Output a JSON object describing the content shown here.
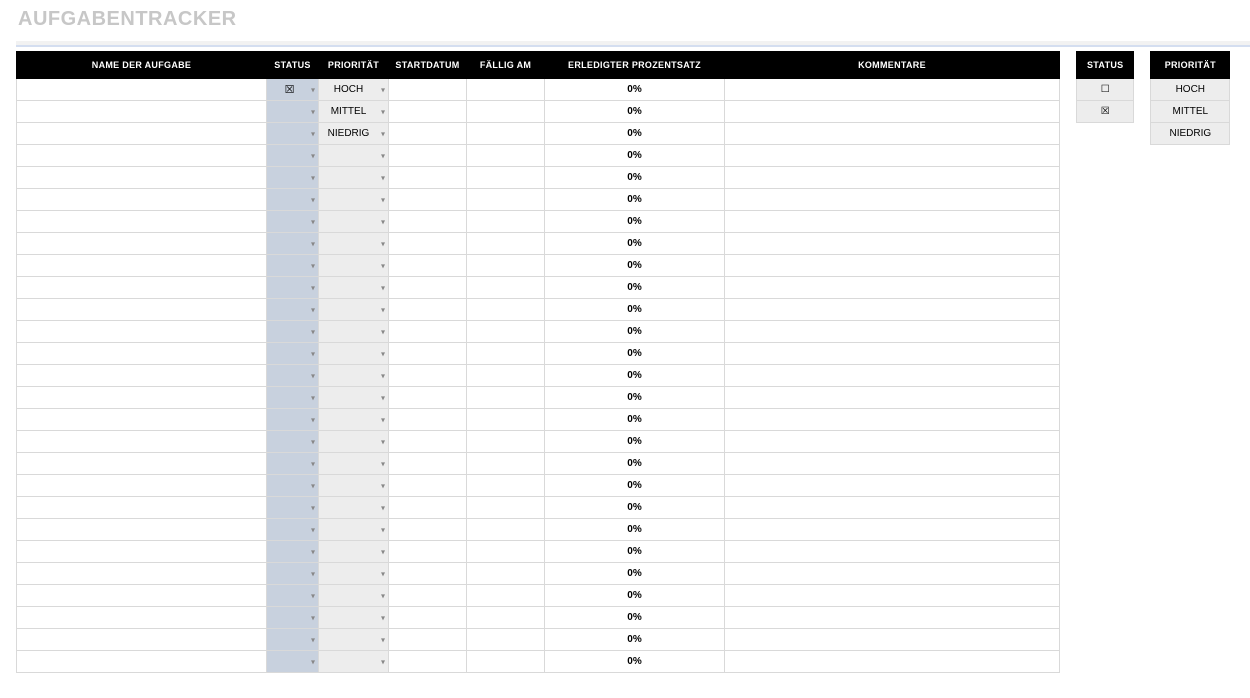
{
  "title": "AUFGABENTRACKER",
  "columns": {
    "name": "NAME DER AUFGABE",
    "status": "STATUS",
    "priority": "PRIORITÄT",
    "start": "STARTDATUM",
    "due": "FÄLLIG AM",
    "pct": "ERLEDIGTER PROZENTSATZ",
    "comments": "KOMMENTARE"
  },
  "rows": [
    {
      "name": "",
      "status": "☒",
      "priority": "HOCH",
      "start": "",
      "due": "",
      "pct": "0%",
      "comments": ""
    },
    {
      "name": "",
      "status": "",
      "priority": "MITTEL",
      "start": "",
      "due": "",
      "pct": "0%",
      "comments": ""
    },
    {
      "name": "",
      "status": "",
      "priority": "NIEDRIG",
      "start": "",
      "due": "",
      "pct": "0%",
      "comments": ""
    },
    {
      "name": "",
      "status": "",
      "priority": "",
      "start": "",
      "due": "",
      "pct": "0%",
      "comments": ""
    },
    {
      "name": "",
      "status": "",
      "priority": "",
      "start": "",
      "due": "",
      "pct": "0%",
      "comments": ""
    },
    {
      "name": "",
      "status": "",
      "priority": "",
      "start": "",
      "due": "",
      "pct": "0%",
      "comments": ""
    },
    {
      "name": "",
      "status": "",
      "priority": "",
      "start": "",
      "due": "",
      "pct": "0%",
      "comments": ""
    },
    {
      "name": "",
      "status": "",
      "priority": "",
      "start": "",
      "due": "",
      "pct": "0%",
      "comments": ""
    },
    {
      "name": "",
      "status": "",
      "priority": "",
      "start": "",
      "due": "",
      "pct": "0%",
      "comments": ""
    },
    {
      "name": "",
      "status": "",
      "priority": "",
      "start": "",
      "due": "",
      "pct": "0%",
      "comments": ""
    },
    {
      "name": "",
      "status": "",
      "priority": "",
      "start": "",
      "due": "",
      "pct": "0%",
      "comments": ""
    },
    {
      "name": "",
      "status": "",
      "priority": "",
      "start": "",
      "due": "",
      "pct": "0%",
      "comments": ""
    },
    {
      "name": "",
      "status": "",
      "priority": "",
      "start": "",
      "due": "",
      "pct": "0%",
      "comments": ""
    },
    {
      "name": "",
      "status": "",
      "priority": "",
      "start": "",
      "due": "",
      "pct": "0%",
      "comments": ""
    },
    {
      "name": "",
      "status": "",
      "priority": "",
      "start": "",
      "due": "",
      "pct": "0%",
      "comments": ""
    },
    {
      "name": "",
      "status": "",
      "priority": "",
      "start": "",
      "due": "",
      "pct": "0%",
      "comments": ""
    },
    {
      "name": "",
      "status": "",
      "priority": "",
      "start": "",
      "due": "",
      "pct": "0%",
      "comments": ""
    },
    {
      "name": "",
      "status": "",
      "priority": "",
      "start": "",
      "due": "",
      "pct": "0%",
      "comments": ""
    },
    {
      "name": "",
      "status": "",
      "priority": "",
      "start": "",
      "due": "",
      "pct": "0%",
      "comments": ""
    },
    {
      "name": "",
      "status": "",
      "priority": "",
      "start": "",
      "due": "",
      "pct": "0%",
      "comments": ""
    },
    {
      "name": "",
      "status": "",
      "priority": "",
      "start": "",
      "due": "",
      "pct": "0%",
      "comments": ""
    },
    {
      "name": "",
      "status": "",
      "priority": "",
      "start": "",
      "due": "",
      "pct": "0%",
      "comments": ""
    },
    {
      "name": "",
      "status": "",
      "priority": "",
      "start": "",
      "due": "",
      "pct": "0%",
      "comments": ""
    },
    {
      "name": "",
      "status": "",
      "priority": "",
      "start": "",
      "due": "",
      "pct": "0%",
      "comments": ""
    },
    {
      "name": "",
      "status": "",
      "priority": "",
      "start": "",
      "due": "",
      "pct": "0%",
      "comments": ""
    },
    {
      "name": "",
      "status": "",
      "priority": "",
      "start": "",
      "due": "",
      "pct": "0%",
      "comments": ""
    },
    {
      "name": "",
      "status": "",
      "priority": "",
      "start": "",
      "due": "",
      "pct": "0%",
      "comments": ""
    }
  ],
  "legend_status": {
    "header": "STATUS",
    "values": [
      "☐",
      "☒"
    ]
  },
  "legend_priority": {
    "header": "PRIORITÄT",
    "values": [
      "HOCH",
      "MITTEL",
      "NIEDRIG"
    ]
  }
}
